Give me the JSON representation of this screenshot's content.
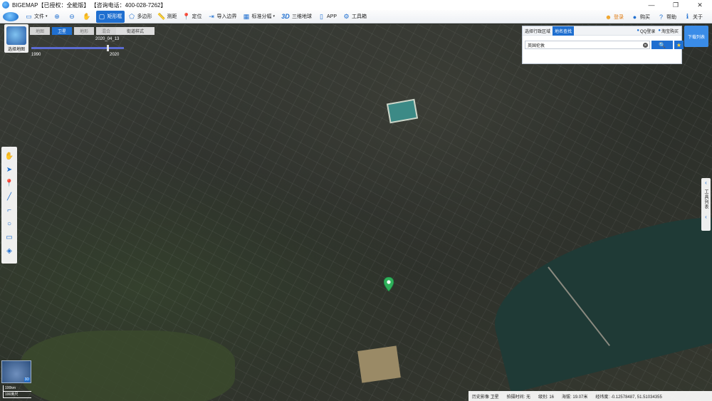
{
  "window": {
    "title": "BIGEMAP【已授权：全能版】 【咨询电话：400-028-7262】",
    "controls": [
      "—",
      "❐",
      "✕"
    ]
  },
  "toolbar": {
    "file": "文件",
    "rect": "矩形框",
    "polygon": "多边形",
    "measure": "测距",
    "locate": "定位",
    "import_boundary": "导入边界",
    "grid": "标准分幅",
    "globe3d_prefix": "3D",
    "globe3d": "三维地球",
    "app": "APP",
    "toolbox": "工具箱",
    "login": "登录",
    "buy": "购买",
    "help": "帮助",
    "about": "关于"
  },
  "maptype": {
    "layer_label": "选择地图",
    "types": [
      "地图",
      "卫星",
      "地形",
      "混合"
    ],
    "selected": "卫星",
    "street_style": "街道样式",
    "timeline_date": "2020_04_13",
    "year_start": "1990",
    "year_end": "2020"
  },
  "search": {
    "tab_admin": "选择行政区域",
    "tab_name": "地名查找",
    "qq_login": "QQ登录",
    "taobao": "淘宝购买",
    "query": "英国伦敦",
    "search_icon": "🔍",
    "star_icon": "★"
  },
  "download": {
    "label": "下载列表"
  },
  "right_tools": {
    "label": "工具列表"
  },
  "minimap": {
    "badge": "3D"
  },
  "scale": {
    "line1": "100km",
    "line2": "100英尺"
  },
  "status": {
    "history": "历史影像 卫星",
    "capture_time": "拍摄时间: 无",
    "level": "级别: 16",
    "altitude": "海拔: 19.07米",
    "lonlat": "经纬度: -0.12578487, 51.51034355"
  },
  "colors": {
    "accent": "#1f6fd0",
    "river": "#1f3a36",
    "marker": "#2fb05a"
  }
}
